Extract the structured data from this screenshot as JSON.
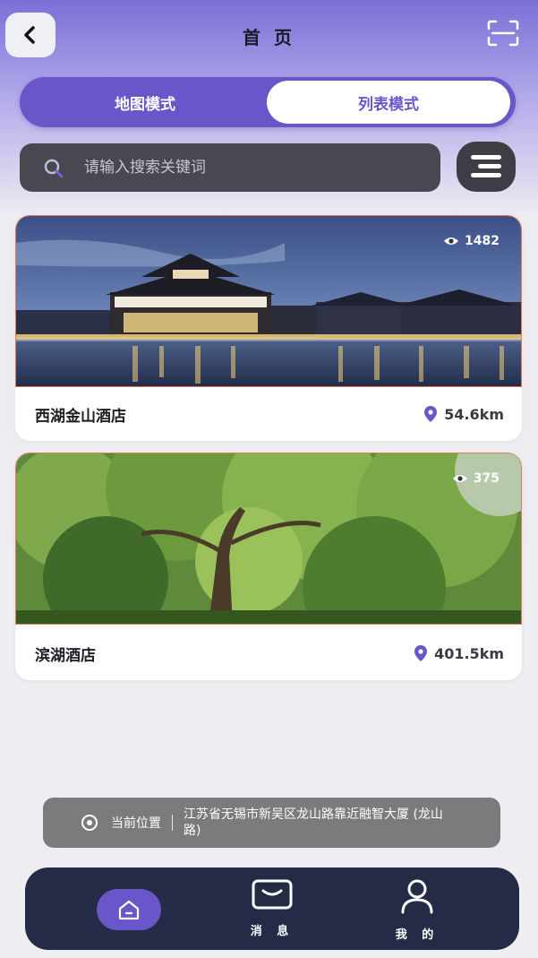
{
  "header": {
    "title": "首 页"
  },
  "mode_toggle": {
    "map_label": "地图模式",
    "list_label": "列表模式",
    "active": "list"
  },
  "search": {
    "placeholder": "请输入搜索关键词"
  },
  "cards": [
    {
      "name": "西湖金山酒店",
      "views": "1482",
      "distance": "54.6km"
    },
    {
      "name": "滨湖酒店",
      "views": "375",
      "distance": "401.5km"
    }
  ],
  "location": {
    "label": "当前位置",
    "address": "江苏省无锡市新吴区龙山路靠近融智大厦 (龙山路)"
  },
  "bottom_nav": {
    "home_label": "",
    "messages_label": "消 息",
    "me_label": "我 的"
  },
  "colors": {
    "accent": "#6a55c9",
    "nav_bg": "#252a47",
    "search_bg": "#484850"
  },
  "icons": [
    "back-icon",
    "scan-icon",
    "search-icon",
    "filter-icon",
    "eye-icon",
    "location-pin-icon",
    "target-icon",
    "home-icon",
    "message-icon",
    "user-icon"
  ]
}
